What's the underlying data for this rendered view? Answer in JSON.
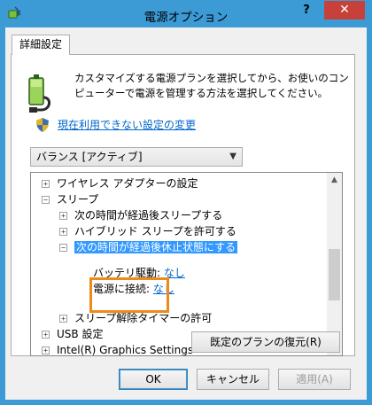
{
  "window": {
    "title": "電源オプション",
    "help": "?",
    "close": "✕"
  },
  "tab": {
    "label": "詳細設定"
  },
  "description": "カスタマイズする電源プランを選択してから、お使いのコンピューターで電源を管理する方法を選択してください。",
  "link": "現在利用できない設定の変更",
  "plan_select": {
    "value": "バランス [アクティブ]"
  },
  "tree": {
    "items": [
      {
        "label": "ワイヤレス アダプターの設定",
        "expander": "+"
      },
      {
        "label": "スリープ",
        "expander": "−"
      },
      {
        "label": "次の時間が経過後スリープする",
        "expander": "+"
      },
      {
        "label": "ハイブリッド スリープを許可する",
        "expander": "+"
      },
      {
        "label": "次の時間が経過後休止状態にする",
        "expander": "−"
      },
      {
        "label": "バッテリ駆動:",
        "value": "なし"
      },
      {
        "label": "電源に接続:",
        "value": "なし"
      },
      {
        "label": "スリープ解除タイマーの許可",
        "expander": "+"
      },
      {
        "label": "USB 設定",
        "expander": "+"
      },
      {
        "label": "Intel(R) Graphics Settings",
        "expander": "+"
      }
    ]
  },
  "buttons": {
    "restore": "既定のプランの復元(R)",
    "ok": "OK",
    "cancel": "キャンセル",
    "apply": "適用(A)"
  },
  "colors": {
    "titlebar": "#3c9ad5",
    "close": "#c7413a",
    "selection": "#3399ff",
    "highlight_box": "#ed8a1a",
    "link": "#0066cc"
  }
}
